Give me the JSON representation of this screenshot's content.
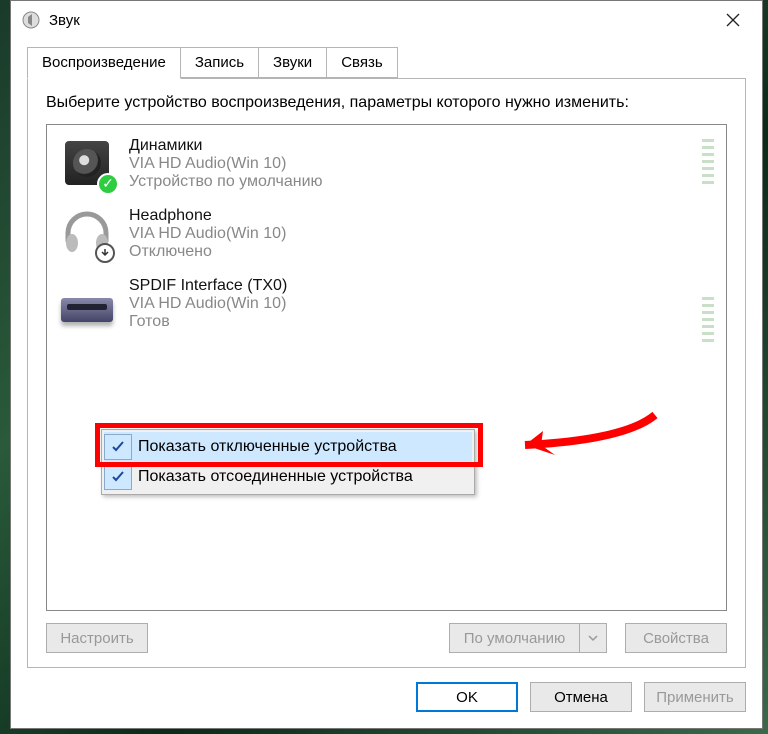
{
  "window": {
    "title": "Звук"
  },
  "tabs": {
    "playback": "Воспроизведение",
    "recording": "Запись",
    "sounds": "Звуки",
    "communications": "Связь"
  },
  "instruction": "Выберите устройство воспроизведения, параметры которого нужно изменить:",
  "devices": [
    {
      "name": "Динамики",
      "driver": "VIA HD Audio(Win 10)",
      "status": "Устройство по умолчанию"
    },
    {
      "name": "Headphone",
      "driver": "VIA HD Audio(Win 10)",
      "status": "Отключено"
    },
    {
      "name": "SPDIF Interface (TX0)",
      "driver": "VIA HD Audio(Win 10)",
      "status": "Готов"
    }
  ],
  "context_menu": {
    "show_disabled": "Показать отключенные устройства",
    "show_disconnected": "Показать отсоединенные устройства"
  },
  "buttons": {
    "configure": "Настроить",
    "set_default": "По умолчанию",
    "properties": "Свойства",
    "ok": "OK",
    "cancel": "Отмена",
    "apply": "Применить"
  }
}
